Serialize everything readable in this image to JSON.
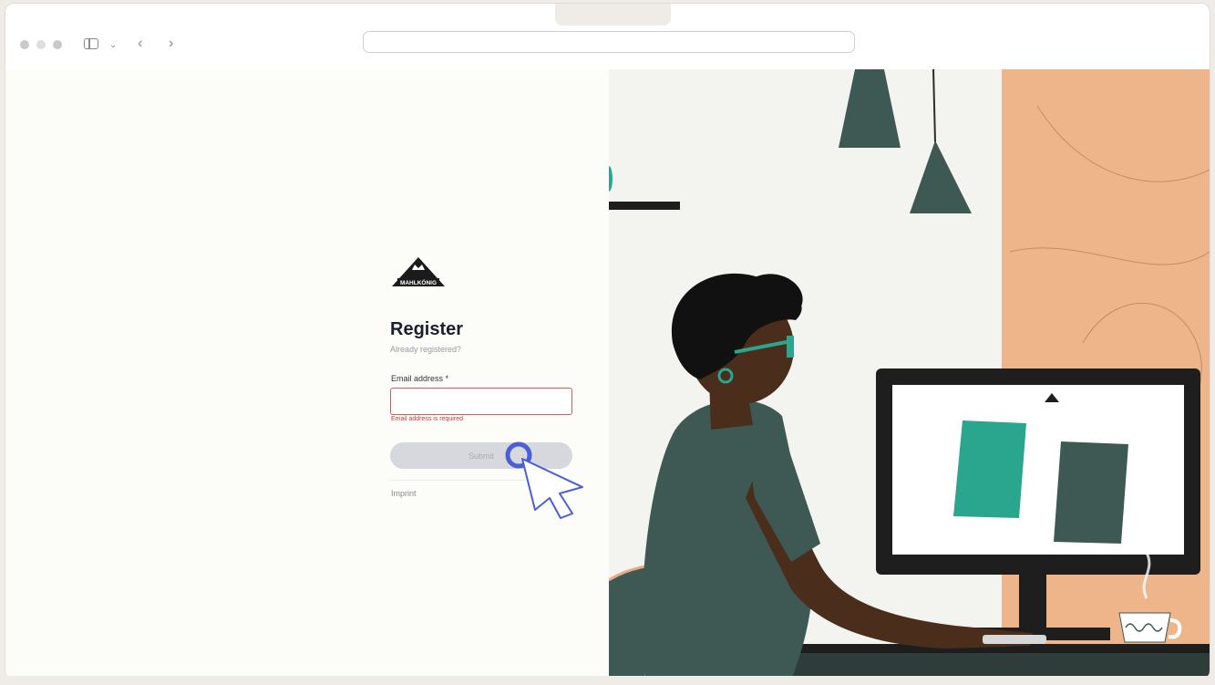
{
  "browser": {
    "address_value": "",
    "icons": [
      "window-dot-icon",
      "sidebar-toggle-icon",
      "chevron-down-icon",
      "back-arrow-icon",
      "forward-arrow-icon"
    ]
  },
  "brand": {
    "logo_text": "MAHLKÖNIG"
  },
  "form": {
    "title": "Register",
    "subtitle": "Already registered?",
    "email_label": "Email address *",
    "email_value": "",
    "email_error": "Email address is required",
    "submit_label": "Submit",
    "imprint_label": "Imprint"
  },
  "colors": {
    "error": "#d06060",
    "accent_teal": "#2aa58e",
    "slate": "#3e5853",
    "peach": "#eeb48a",
    "cursor_blue": "#4a5fd6"
  }
}
